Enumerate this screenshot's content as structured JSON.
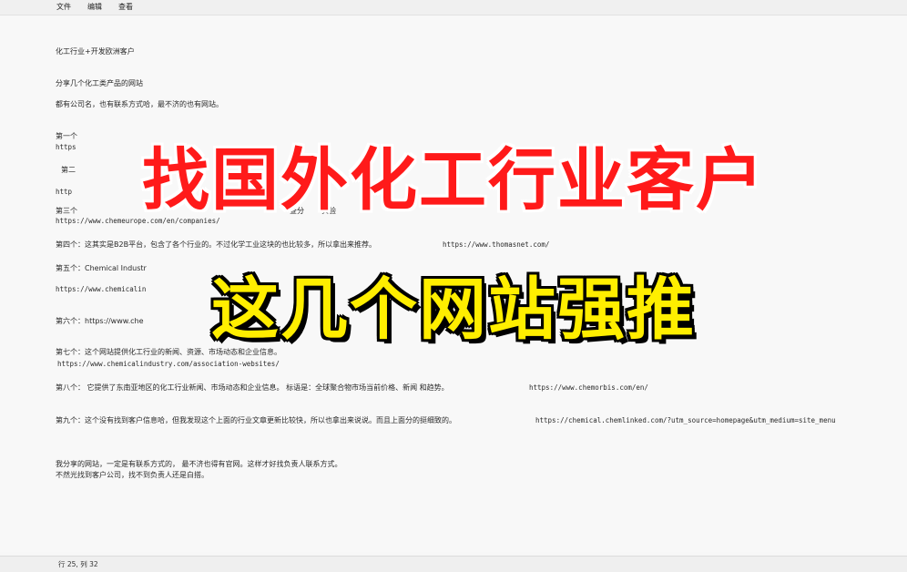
{
  "menu": {
    "file": "文件",
    "edit": "编辑",
    "view": "查看"
  },
  "lines": {
    "l1": "化工行业+开发欧洲客户",
    "l2": "分享几个化工类产品的网站",
    "l3": "都有公司名，也有联系方式哈，最不济的也有网站。",
    "l4": "第一个",
    "l5": "https",
    "l6": "第二",
    "l7": "http",
    "l8a": "第三个",
    "l8b": "查分",
    "l8c": "实验",
    "l9": "https://www.chemeurope.com/en/companies/",
    "l10a": "第四个：这其实是B2B平台，包含了各个行业的。不过化学工业这块的也比较多，所以拿出来推荐。",
    "l10b": "https://www.thomasnet.com/",
    "l11a": "第五个：Chemical Industr",
    "l12": "https://www.chemicalin",
    "l13": "第六个：https://www.che",
    "l14": "第七个：这个网站提供化工行业的新闻、资源、市场动态和企业信息。",
    "l15": "https://www.chemicalindustry.com/association-websites/",
    "l16a": "第八个： 它提供了东南亚地区的化工行业新闻、市场动态和企业信息。 标语是：全球聚合物市场当前价格、新闻 和趋势。",
    "l16b": "https://www.chemorbis.com/en/",
    "l17a": "第九个：这个没有找到客户信息哈，但我发现这个上面的行业文章更新比较快，所以也拿出来说说。而且上面分的挺细致的。",
    "l17b": "https://chemical.chemlinked.com/?utm_source=homepage&utm_medium=site_menu",
    "l18": "我分享的网站，一定是有联系方式的， 最不济也得有官网。这样才好找负责人联系方式。",
    "l19": "不然光找到客户公司，找不到负责人还是白搭。"
  },
  "overlay": {
    "title": "找国外化工行业客户",
    "subtitle": "这几个网站强推"
  },
  "status": {
    "position": "行 25, 列 32"
  },
  "colors": {
    "title": "#ff1a1a",
    "subtitle": "#ffee00"
  }
}
